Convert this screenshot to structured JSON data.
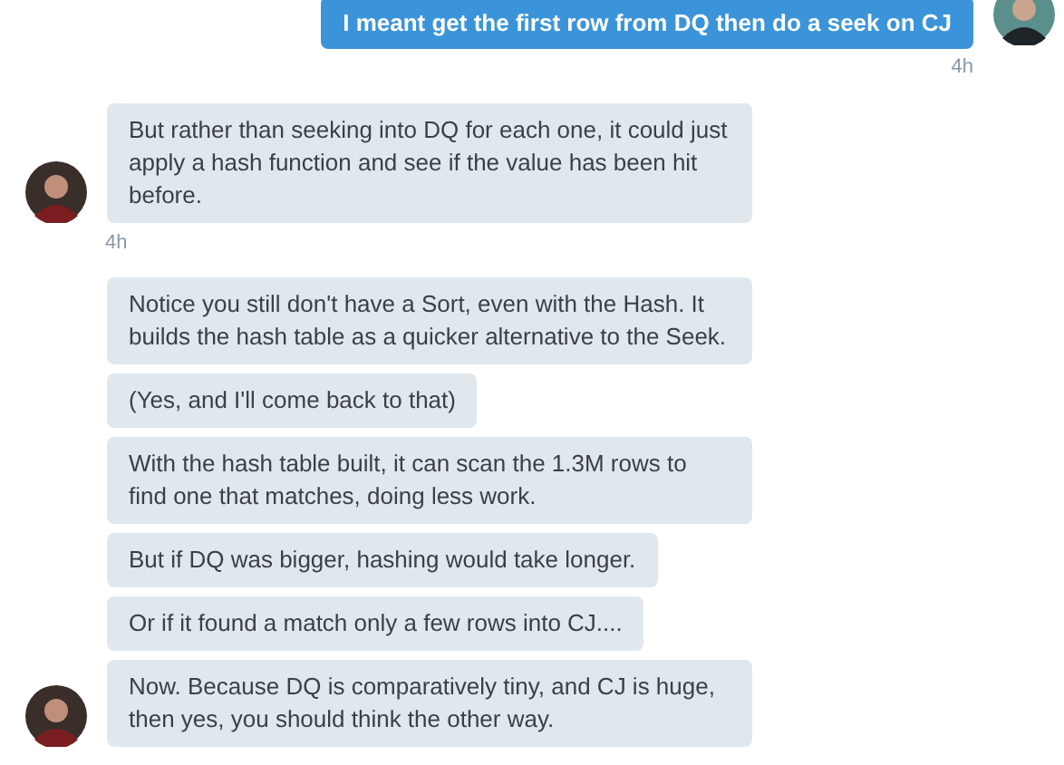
{
  "messages": [
    {
      "kind": "outgoing",
      "bubbles": [
        "I meant get the first row from DQ then do a seek on CJ"
      ],
      "time": "4h"
    },
    {
      "kind": "incoming",
      "bubbles": [
        "But rather than seeking into DQ for each one, it could just apply a hash function and see if the value has been hit before."
      ],
      "time": "4h"
    },
    {
      "kind": "incoming",
      "bubbles": [
        "Notice you still don't have a Sort, even with the Hash. It builds the hash table as a quicker alternative to the Seek.",
        "(Yes, and I'll come back to that)",
        "With the hash table built, it can scan the 1.3M rows to find one that matches, doing less work.",
        "But if DQ was bigger, hashing would take longer.",
        "Or if it found a match only a few rows into CJ....",
        "Now. Because DQ is comparatively tiny, and CJ is huge, then yes, you should think the other way."
      ]
    }
  ]
}
